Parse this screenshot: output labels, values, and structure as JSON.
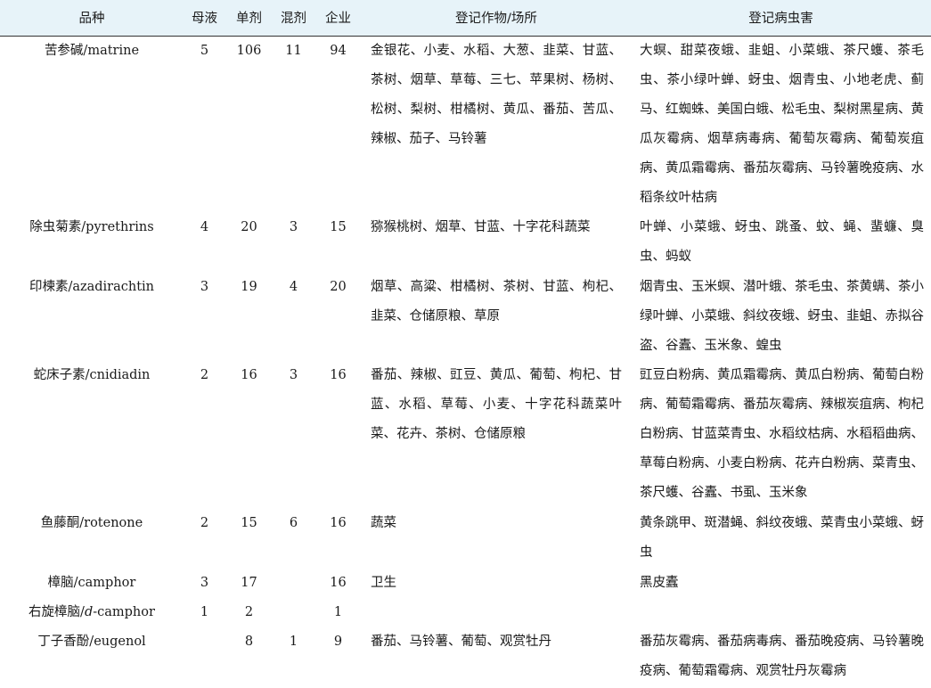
{
  "header": {
    "variety": "品种",
    "mother_liquor": "母液",
    "single": "单剂",
    "mixed": "混剂",
    "companies": "企业",
    "crops": "登记作物/场所",
    "pests": "登记病虫害"
  },
  "rows": [
    {
      "variety": "苦参碱/matrine",
      "mother_liquor": "5",
      "single": "106",
      "mixed": "11",
      "companies": "94",
      "crops": "金银花、小麦、水稻、大葱、韭菜、甘蓝、茶树、烟草、草莓、三七、苹果树、杨树、松树、梨树、柑橘树、黄瓜、番茄、苦瓜、辣椒、茄子、马铃薯",
      "pests": "大螟、甜菜夜蛾、韭蛆、小菜蛾、茶尺蠖、茶毛虫、茶小绿叶蝉、蚜虫、烟青虫、小地老虎、蓟马、红蜘蛛、美国白蛾、松毛虫、梨树黑星病、黄瓜灰霉病、烟草病毒病、葡萄灰霉病、葡萄炭疽病、黄瓜霜霉病、番茄灰霉病、马铃薯晚疫病、水稻条纹叶枯病"
    },
    {
      "variety": "除虫菊素/pyrethrins",
      "mother_liquor": "4",
      "single": "20",
      "mixed": "3",
      "companies": "15",
      "crops": "猕猴桃树、烟草、甘蓝、十字花科蔬菜",
      "pests": "叶蝉、小菜蛾、蚜虫、跳蚤、蚊、蝇、蜚蠊、臭虫、蚂蚁"
    },
    {
      "variety": "印楝素/azadirachtin",
      "mother_liquor": "3",
      "single": "19",
      "mixed": "4",
      "companies": "20",
      "crops": "烟草、高粱、柑橘树、茶树、甘蓝、枸杞、韭菜、仓储原粮、草原",
      "pests": "烟青虫、玉米螟、潜叶蛾、茶毛虫、茶黄螨、茶小绿叶蝉、小菜蛾、斜纹夜蛾、蚜虫、韭蛆、赤拟谷盗、谷蠹、玉米象、蝗虫"
    },
    {
      "variety": "蛇床子素/cnidiadin",
      "mother_liquor": "2",
      "single": "16",
      "mixed": "3",
      "companies": "16",
      "crops": "番茄、辣椒、豇豆、黄瓜、葡萄、枸杞、甘蓝、水稻、草莓、小麦、十字花科蔬菜叶菜、花卉、茶树、仓储原粮",
      "pests": "豇豆白粉病、黄瓜霜霉病、黄瓜白粉病、葡萄白粉病、葡萄霜霉病、番茄灰霉病、辣椒炭疽病、枸杞白粉病、甘蓝菜青虫、水稻纹枯病、水稻稻曲病、草莓白粉病、小麦白粉病、花卉白粉病、菜青虫、茶尺蠖、谷蠹、书虱、玉米象"
    },
    {
      "variety": "鱼藤酮/rotenone",
      "mother_liquor": "2",
      "single": "15",
      "mixed": "6",
      "companies": "16",
      "crops": "蔬菜",
      "pests": "黄条跳甲、斑潜蝇、斜纹夜蛾、菜青虫小菜蛾、蚜虫"
    },
    {
      "variety": "樟脑/camphor",
      "mother_liquor": "3",
      "single": "17",
      "mixed": "",
      "companies": "16",
      "crops": "卫生",
      "pests": "黑皮蠹"
    },
    {
      "variety_prefix": "右旋樟脑/",
      "variety_italic": "d",
      "variety_suffix": "-camphor",
      "mother_liquor": "1",
      "single": "2",
      "mixed": "",
      "companies": "1",
      "crops": "",
      "pests": ""
    },
    {
      "variety": "丁子香酚/eugenol",
      "mother_liquor": "",
      "single": "8",
      "mixed": "1",
      "companies": "9",
      "crops": "番茄、马铃薯、葡萄、观赏牡丹",
      "pests": "番茄灰霉病、番茄病毒病、番茄晚疫病、马铃薯晚疫病、葡萄霜霉病、观赏牡丹灰霉病"
    }
  ]
}
